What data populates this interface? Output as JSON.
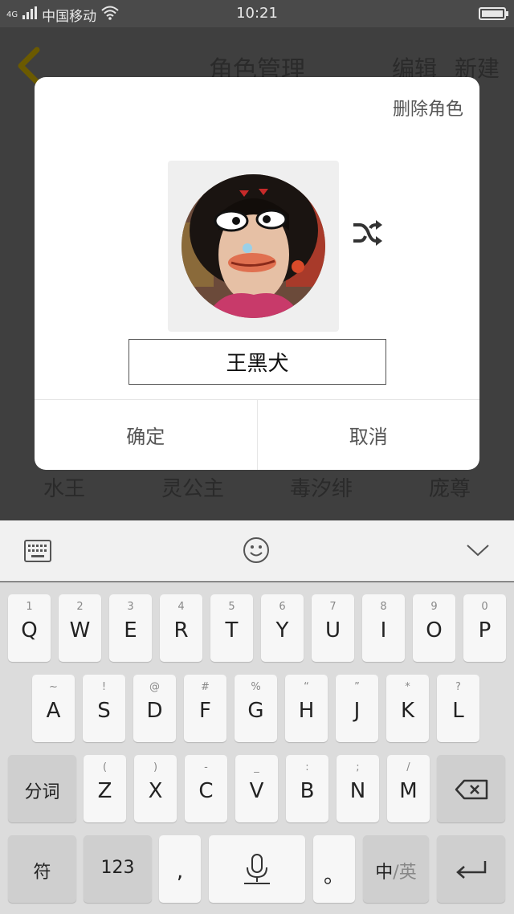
{
  "status_bar": {
    "network": "4G",
    "carrier": "中国移动",
    "time": "10:21"
  },
  "app": {
    "title": "角色管理",
    "actions": [
      "编辑",
      "新建"
    ],
    "names": [
      "水王",
      "灵公主",
      "毒汐绯",
      "庞尊"
    ]
  },
  "dialog": {
    "delete_label": "删除角色",
    "name_value": "王黑犬",
    "confirm_label": "确定",
    "cancel_label": "取消"
  },
  "keyboard": {
    "row1": [
      {
        "hint": "1",
        "key": "Q"
      },
      {
        "hint": "2",
        "key": "W"
      },
      {
        "hint": "3",
        "key": "E"
      },
      {
        "hint": "4",
        "key": "R"
      },
      {
        "hint": "5",
        "key": "T"
      },
      {
        "hint": "6",
        "key": "Y"
      },
      {
        "hint": "7",
        "key": "U"
      },
      {
        "hint": "8",
        "key": "I"
      },
      {
        "hint": "9",
        "key": "O"
      },
      {
        "hint": "0",
        "key": "P"
      }
    ],
    "row2": [
      {
        "hint": "~",
        "key": "A"
      },
      {
        "hint": "!",
        "key": "S"
      },
      {
        "hint": "@",
        "key": "D"
      },
      {
        "hint": "#",
        "key": "F"
      },
      {
        "hint": "%",
        "key": "G"
      },
      {
        "hint": "“",
        "key": "H"
      },
      {
        "hint": "”",
        "key": "J"
      },
      {
        "hint": "*",
        "key": "K"
      },
      {
        "hint": "?",
        "key": "L"
      }
    ],
    "row3": [
      {
        "hint": "(",
        "key": "Z"
      },
      {
        "hint": ")",
        "key": "X"
      },
      {
        "hint": "-",
        "key": "C"
      },
      {
        "hint": "_",
        "key": "V"
      },
      {
        "hint": ":",
        "key": "B"
      },
      {
        "hint": ";",
        "key": "N"
      },
      {
        "hint": "/",
        "key": "M"
      }
    ],
    "segment_label": "分词",
    "symbol_label": "符",
    "number_label": "123",
    "comma_label": ",",
    "period_label": "。",
    "lang_active": "中",
    "lang_sep": "/",
    "lang_inactive": "英"
  }
}
